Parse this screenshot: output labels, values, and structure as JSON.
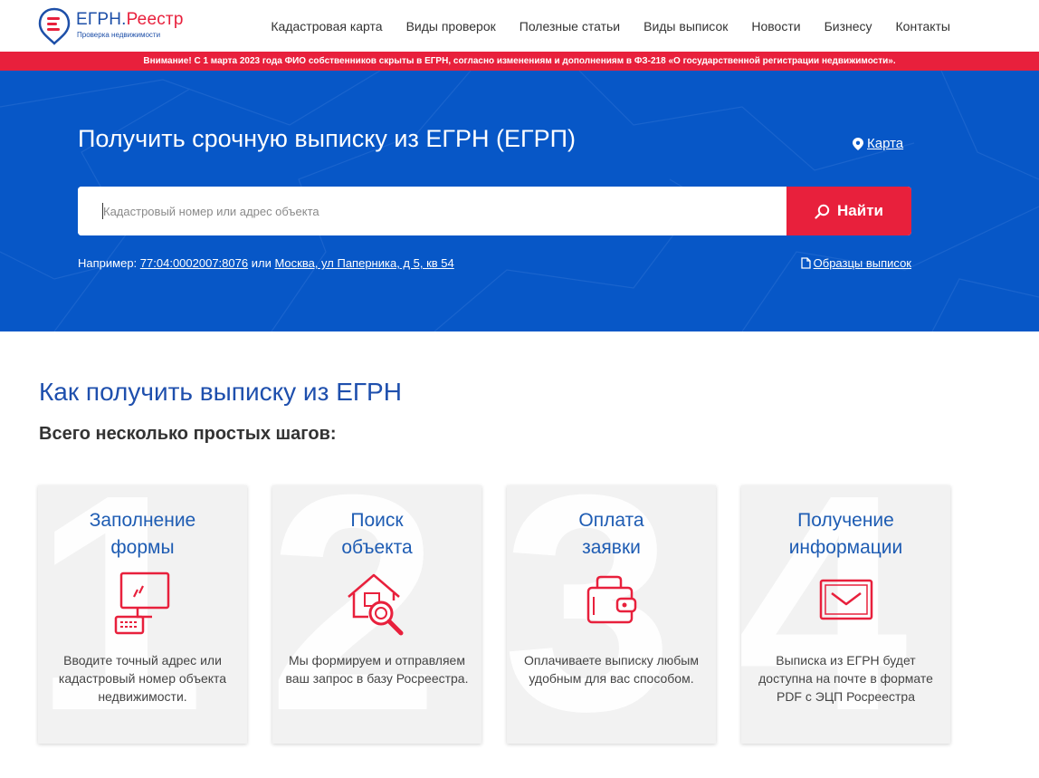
{
  "header": {
    "logo_title_main": "ЕГРН.",
    "logo_title_accent": "Реестр",
    "logo_subtitle": "Проверка недвижимости",
    "nav": [
      "Кадастровая карта",
      "Виды проверок",
      "Полезные статьи",
      "Виды выписок",
      "Новости",
      "Бизнесу",
      "Контакты"
    ]
  },
  "alert": "Внимание! С 1 марта 2023 года ФИО собственников скрыты в ЕГРН, согласно изменениям и дополнениям в ФЗ-218 «О государственной регистрации недвижимости».",
  "hero": {
    "title": "Получить срочную выписку из ЕГРН (ЕГРП)",
    "map_link": "Карта",
    "search_placeholder": "Кадастровый номер или адрес объекта",
    "search_value": "",
    "search_button": "Найти",
    "example_prefix": "Например:",
    "example_cadastral": "77:04:0002007:8076",
    "example_or": "или",
    "example_address": "Москва, ул Паперника, д 5, кв 54",
    "samples_link": "Образцы выписок"
  },
  "steps": {
    "title": "Как получить выписку из ЕГРН",
    "subtitle": "Всего несколько простых шагов:",
    "cards": [
      {
        "num": "1",
        "title_l1": "Заполнение",
        "title_l2": "формы",
        "text": "Вводите точный адрес или кадастровый номер объекта недвижимости.",
        "icon": "computer-icon"
      },
      {
        "num": "2",
        "title_l1": "Поиск",
        "title_l2": "объекта",
        "text": "Мы формируем и отправляем ваш запрос в базу Росреестра.",
        "icon": "house-search-icon"
      },
      {
        "num": "3",
        "title_l1": "Оплата",
        "title_l2": "заявки",
        "text": "Оплачиваете выписку любым удобным для вас способом.",
        "icon": "wallet-icon"
      },
      {
        "num": "4",
        "title_l1": "Получение",
        "title_l2": "информации",
        "text": "Выписка из ЕГРН будет доступна на почте в формате PDF с ЭЦП Росреестра",
        "icon": "envelope-icon"
      }
    ]
  },
  "colors": {
    "brand_blue": "#0757c7",
    "accent_red": "#e8203c",
    "title_blue": "#1e4fad"
  }
}
